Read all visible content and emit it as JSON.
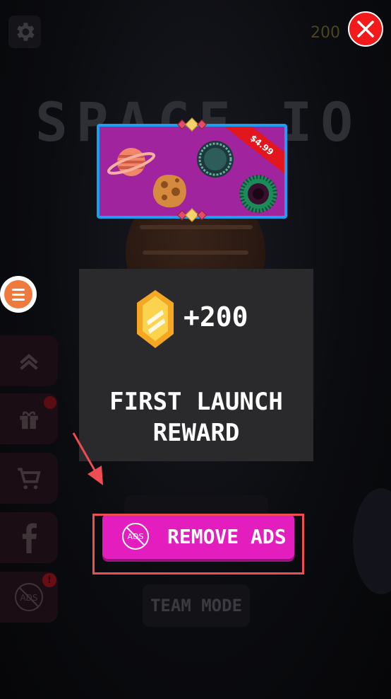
{
  "game": {
    "title_bg": "SPACE IO",
    "coins": "200",
    "team_mode_label": "TEAM MODE"
  },
  "pack": {
    "price": "$4.99"
  },
  "reward": {
    "amount": "+200",
    "title_line1": "FIRST LAUNCH",
    "title_line2": "REWARD"
  },
  "remove_ads": {
    "label": "REMOVE ADS",
    "icon_text": "ADS"
  },
  "sidebar": {
    "items": [
      {
        "icon": "chevron-up-double-icon"
      },
      {
        "icon": "gift-icon",
        "badge": "dot"
      },
      {
        "icon": "cart-icon"
      },
      {
        "icon": "facebook-icon"
      },
      {
        "icon": "no-ads-icon",
        "badge": "!",
        "icon_text": "ADS"
      }
    ]
  },
  "colors": {
    "remove_ads": "#e41ebe",
    "close": "#f21a1a",
    "highlight": "#ee4d52",
    "menu": "#f07a3e",
    "pack_border": "#1e9ef0",
    "pack_bg": "#a0249e"
  }
}
